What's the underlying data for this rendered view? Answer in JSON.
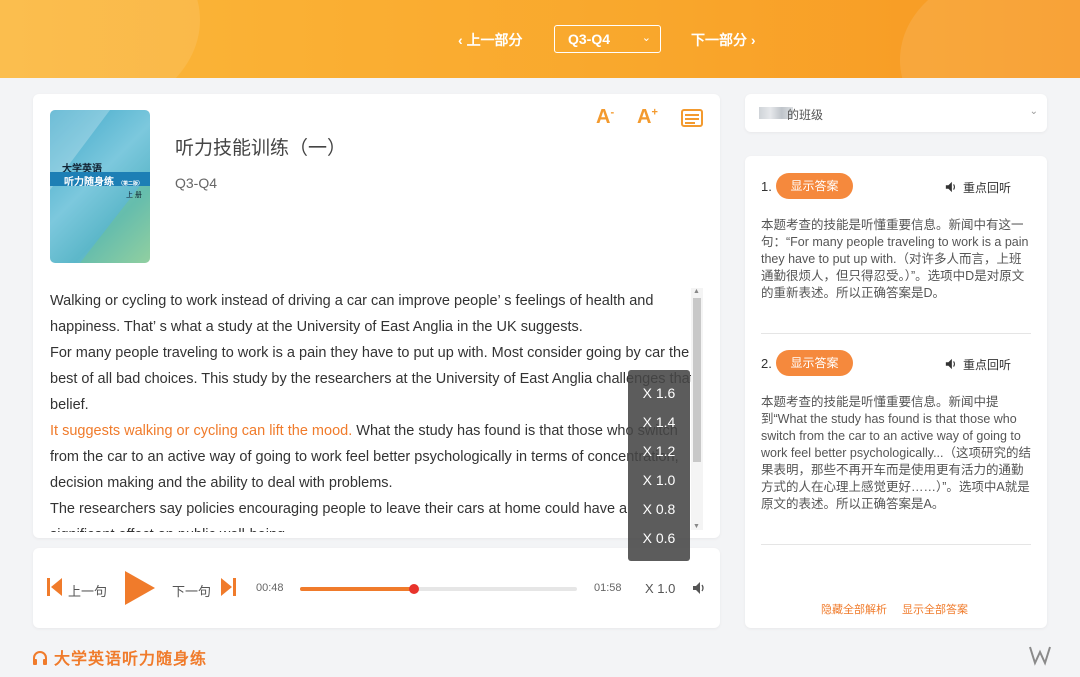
{
  "header": {
    "prev_label": "上一部分",
    "next_label": "下一部分",
    "section_value": "Q3-Q4"
  },
  "book": {
    "title": "听力技能训练（一）",
    "subtitle": "Q3-Q4",
    "cover_title": "大学英语",
    "cover_band": "听力随身练",
    "cover_edition": "（第二版）",
    "cover_volume": "上 册"
  },
  "tools": {
    "font_smaller": "A",
    "font_larger": "A"
  },
  "passage": {
    "p1": "Walking or cycling to work instead of driving a car can improve people’ s feelings of health and happiness. That’ s what a study at the University of East Anglia in the UK suggests.",
    "p2": "For many people traveling to work is a pain they have to put up with. Most consider going by car the best of all bad choices. This study by the researchers at the University of East Anglia challenges that belief.",
    "p3_highlight": "It suggests walking or cycling can lift the mood.",
    "p3_rest": " What the study has found is that those who switch from the car to an active way of going to work feel better psychologically in terms of concentration, decision making and the ability to deal with problems.",
    "p4": "The researchers say policies encouraging people to leave their cars at home could have a significant effect on public well-being."
  },
  "player": {
    "prev_label": "上一句",
    "next_label": "下一句",
    "current_time": "00:48",
    "total_time": "01:58",
    "progress": 0.41,
    "speed": "X 1.0",
    "accent_color": "#f07b2b"
  },
  "speed_menu": [
    "X 1.6",
    "X 1.4",
    "X 1.2",
    "X 1.0",
    "X 0.8",
    "X 0.6"
  ],
  "class_select": {
    "label": "的班级"
  },
  "answers": [
    {
      "num": "1.",
      "button": "显示答案",
      "replay": "重点回听",
      "explanation": "本题考查的技能是听懂重要信息。新闻中有这一句：“For many people traveling to work is a pain they have to put up with.（对许多人而言，上班通勤很烦人，但只得忍受。）”。选项中D是对原文的重新表述。所以正确答案是D。"
    },
    {
      "num": "2.",
      "button": "显示答案",
      "replay": "重点回听",
      "explanation": "本题考查的技能是听懂重要信息。新闻中提到“What the study has found is that those who switch from the car to an active way of going to work feel better psychologically...（这项研究的结果表明，那些不再开车而是使用更有活力的通勤方式的人在心理上感觉更好……）”。选项中A就是原文的表述。所以正确答案是A。"
    }
  ],
  "answer_links": {
    "hide_all": "隐藏全部解析",
    "show_all": "显示全部答案"
  },
  "brand": "大学英语听力随身练"
}
